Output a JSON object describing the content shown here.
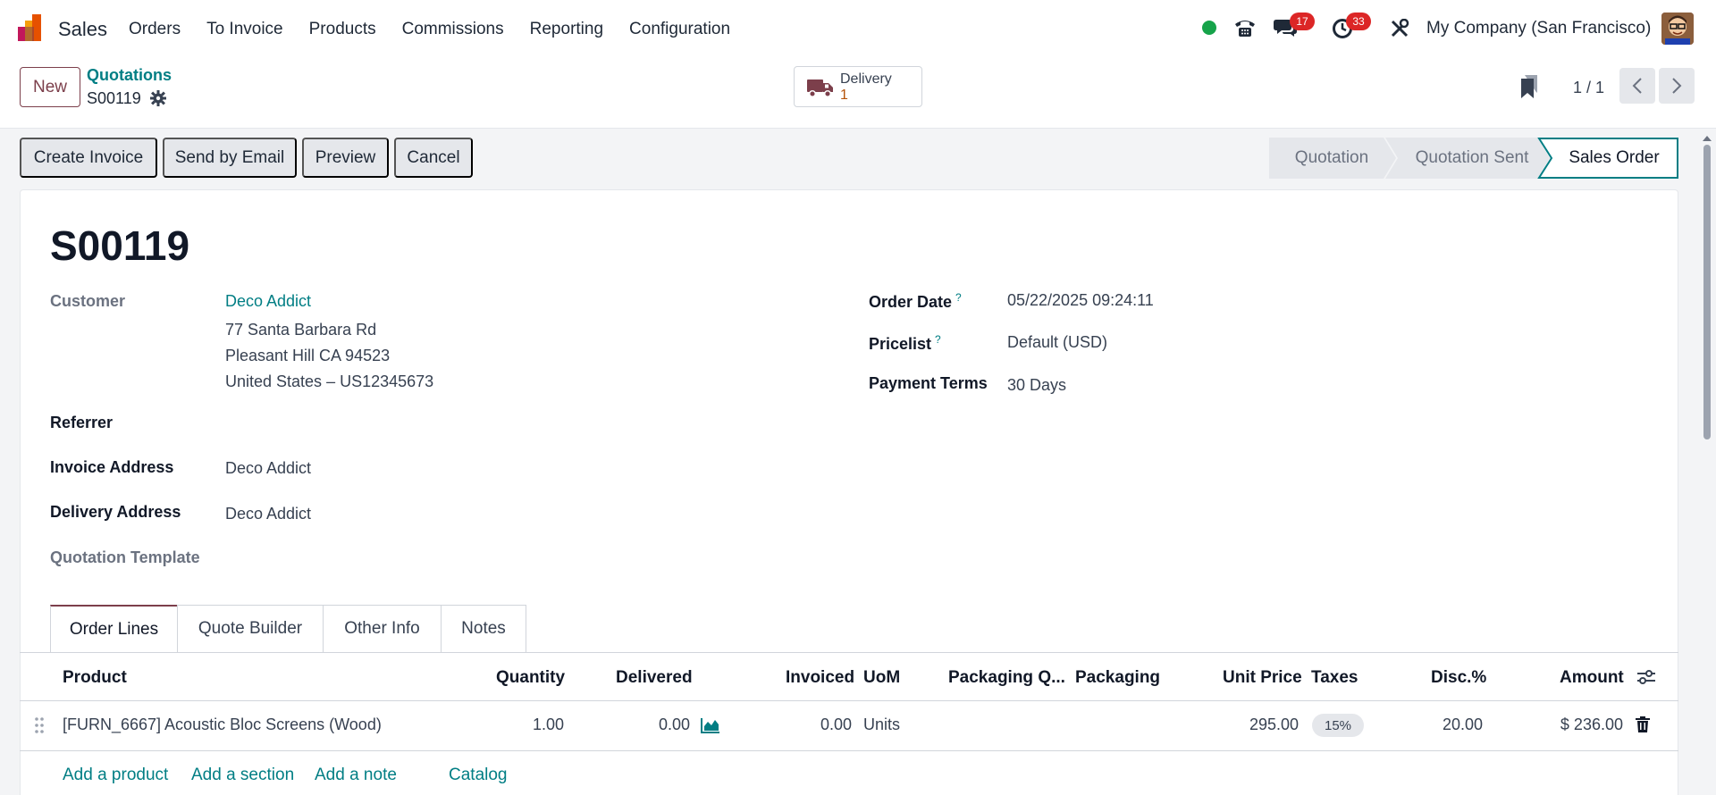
{
  "navbar": {
    "app_name": "Sales",
    "menu": [
      "Orders",
      "To Invoice",
      "Products",
      "Commissions",
      "Reporting",
      "Configuration"
    ],
    "messages_count": "17",
    "activities_count": "33",
    "company": "My Company (San Francisco)",
    "presence_color": "#16a34a"
  },
  "control": {
    "new_label": "New",
    "breadcrumb_parent": "Quotations",
    "breadcrumb_current": "S00119",
    "smart_button": {
      "label": "Delivery",
      "value": "1"
    },
    "pager": "1 / 1"
  },
  "actions": [
    "Create Invoice",
    "Send by Email",
    "Preview",
    "Cancel"
  ],
  "status_steps": [
    "Quotation",
    "Quotation Sent",
    "Sales Order"
  ],
  "status_current": "Sales Order",
  "form": {
    "title": "S00119",
    "customer_label": "Customer",
    "customer_name": "Deco Addict",
    "address_line1": "77 Santa Barbara Rd",
    "address_line2": "Pleasant Hill CA 94523",
    "address_line3": "United States – US12345673",
    "referrer_label": "Referrer",
    "invoice_address_label": "Invoice Address",
    "invoice_address_value": "Deco Addict",
    "delivery_address_label": "Delivery Address",
    "delivery_address_value": "Deco Addict",
    "quotation_template_label": "Quotation Template",
    "order_date_label": "Order Date",
    "order_date_value": "05/22/2025 09:24:11",
    "pricelist_label": "Pricelist",
    "pricelist_value": "Default (USD)",
    "payment_terms_label": "Payment Terms",
    "payment_terms_value": "30 Days",
    "help_mark": "?"
  },
  "tabs": [
    "Order Lines",
    "Quote Builder",
    "Other Info",
    "Notes"
  ],
  "table": {
    "headers": [
      "Product",
      "Quantity",
      "Delivered",
      "Invoiced",
      "UoM",
      "Packaging Q...",
      "Packaging",
      "Unit Price",
      "Taxes",
      "Disc.%",
      "Amount"
    ],
    "rows": [
      {
        "product": "[FURN_6667] Acoustic Bloc Screens (Wood)",
        "quantity": "1.00",
        "delivered": "0.00",
        "invoiced": "0.00",
        "uom": "Units",
        "unit_price": "295.00",
        "tax": "15%",
        "discount": "20.00",
        "amount": "$ 236.00"
      }
    ],
    "add_links": [
      "Add a product",
      "Add a section",
      "Add a note",
      "Catalog"
    ]
  },
  "colors": {
    "brand": "#7c3f4b",
    "link": "#017e84",
    "badge": "#dc2626"
  }
}
